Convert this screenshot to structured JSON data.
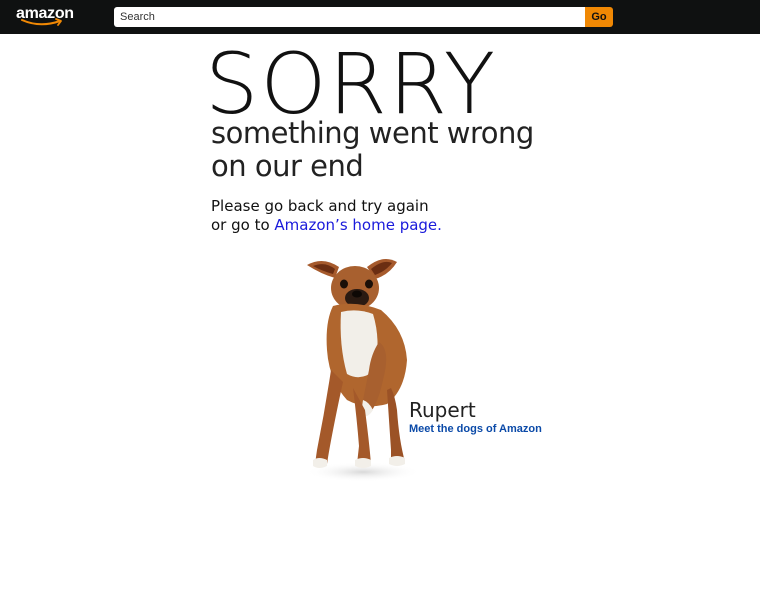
{
  "header": {
    "logo_text": "amazon",
    "search": {
      "placeholder": "Search",
      "value": ""
    },
    "go_label": "Go"
  },
  "error": {
    "heading": "SORRY",
    "subtitle_line1": "something went wrong",
    "subtitle_line2": "on our end",
    "instruction_line1": "Please go back and try again",
    "instruction_prefix": "or go to",
    "home_link": "Amazon’s home page."
  },
  "dog": {
    "name": "Rupert",
    "link": "Meet the dogs of Amazon"
  },
  "colors": {
    "header_bg": "#0f1111",
    "go_button": "#f08804",
    "link_blue": "#1a1adb",
    "smile_orange": "#f08804"
  }
}
